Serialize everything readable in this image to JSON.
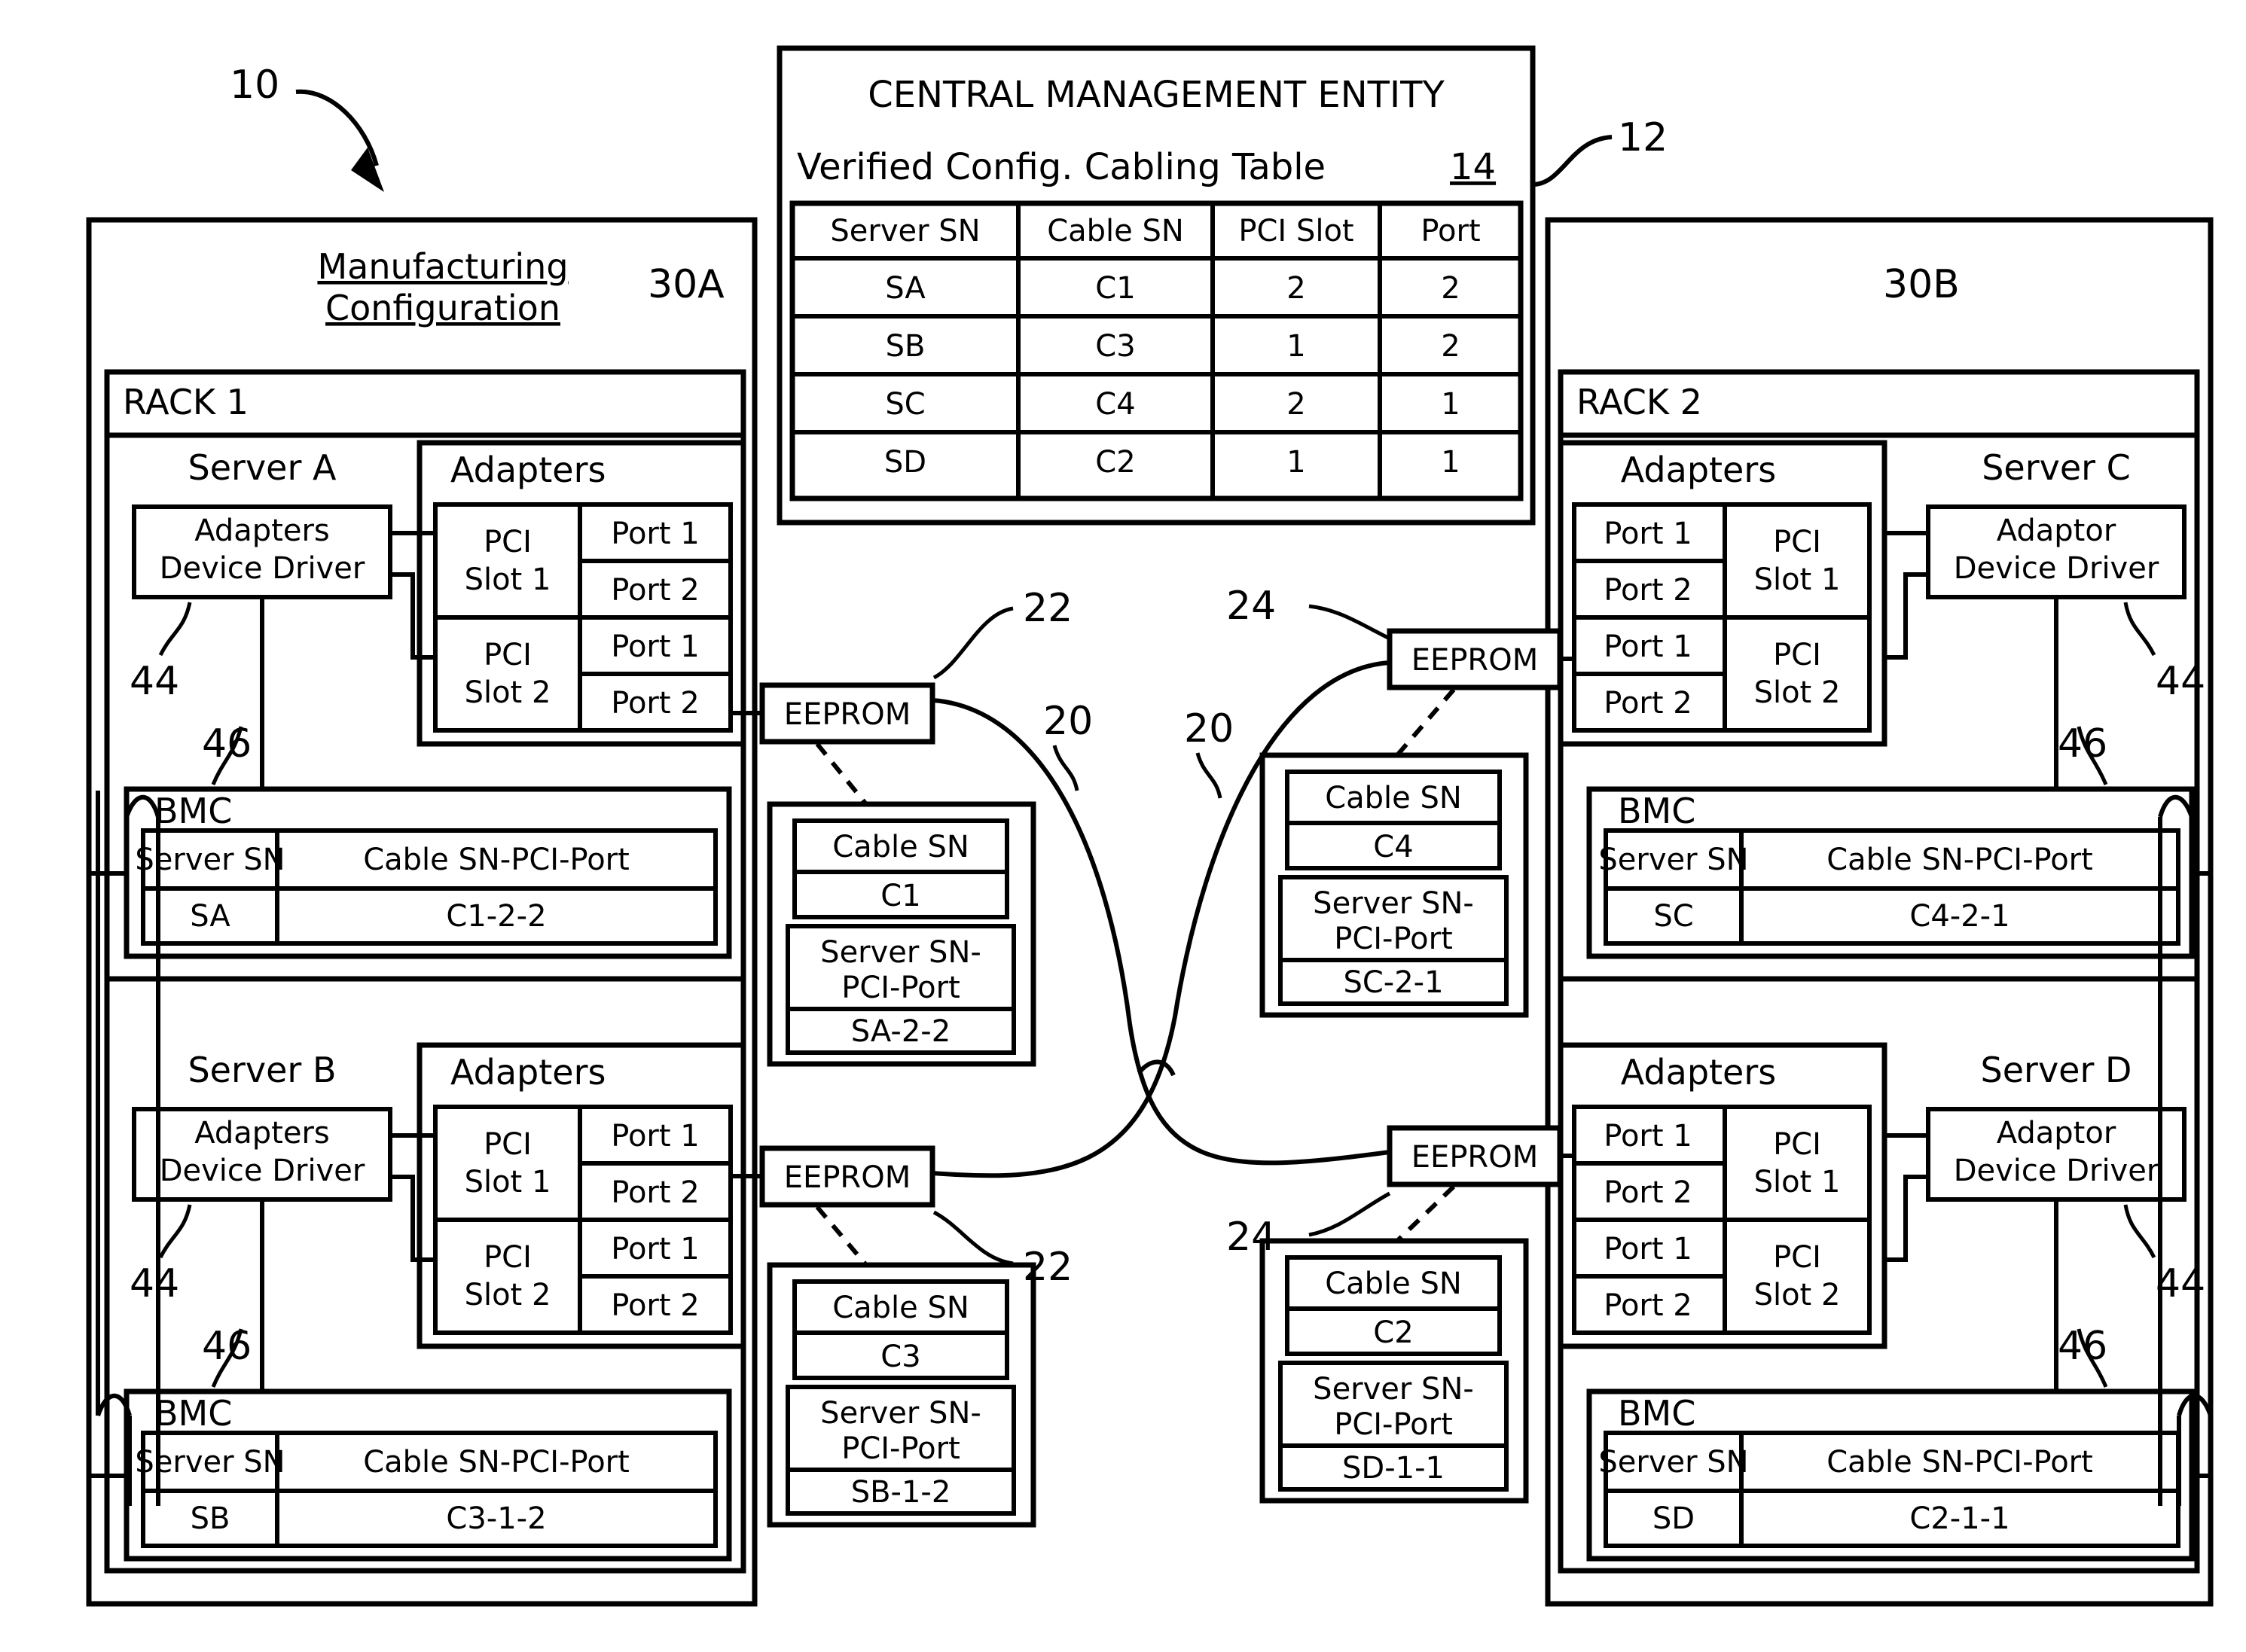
{
  "figure": {
    "ref_system": "10",
    "ref_cme": "12",
    "ref_table": "14",
    "ref_cable_20": "20",
    "ref_cable_22": "22",
    "ref_cable_24": "24",
    "ref_rack_a": "30A",
    "ref_rack_b": "30B",
    "ref_driver": "44",
    "ref_bmc": "46"
  },
  "central_management_entity": {
    "title": "CENTRAL MANAGEMENT ENTITY",
    "table_title": "Verified Config. Cabling Table",
    "table_ref": "14",
    "columns": [
      "Server SN",
      "Cable SN",
      "PCI Slot",
      "Port"
    ],
    "rows": [
      [
        "SA",
        "C1",
        "2",
        "2"
      ],
      [
        "SB",
        "C3",
        "1",
        "2"
      ],
      [
        "SC",
        "C4",
        "2",
        "1"
      ],
      [
        "SD",
        "C2",
        "1",
        "1"
      ]
    ]
  },
  "left_panel": {
    "heading_line1": "Manufacturing",
    "heading_line2": "Configuration",
    "rack_label": "RACK 1",
    "rack_ref": "30A",
    "servers": [
      {
        "name": "Server A",
        "driver_line1": "Adapters",
        "driver_line2": "Device Driver",
        "driver_ref": "44",
        "adapters_label": "Adapters",
        "slots": [
          {
            "slot": "PCI\nSlot 1",
            "slot_l1": "PCI",
            "slot_l2": "Slot 1",
            "ports": [
              "Port 1",
              "Port 2"
            ]
          },
          {
            "slot": "PCI\nSlot 2",
            "slot_l1": "PCI",
            "slot_l2": "Slot 2",
            "ports": [
              "Port 1",
              "Port 2"
            ]
          }
        ],
        "bmc_label": "BMC",
        "bmc_ref": "46",
        "bmc_columns": [
          "Server SN",
          "Cable SN-PCI-Port"
        ],
        "bmc_row": [
          "SA",
          "C1-2-2"
        ]
      },
      {
        "name": "Server B",
        "driver_line1": "Adapters",
        "driver_line2": "Device Driver",
        "driver_ref": "44",
        "adapters_label": "Adapters",
        "slots": [
          {
            "slot_l1": "PCI",
            "slot_l2": "Slot 1",
            "ports": [
              "Port 1",
              "Port 2"
            ]
          },
          {
            "slot_l1": "PCI",
            "slot_l2": "Slot 2",
            "ports": [
              "Port 1",
              "Port 2"
            ]
          }
        ],
        "bmc_label": "BMC",
        "bmc_ref": "46",
        "bmc_columns": [
          "Server SN",
          "Cable SN-PCI-Port"
        ],
        "bmc_row": [
          "SB",
          "C3-1-2"
        ]
      }
    ]
  },
  "right_panel": {
    "rack_label": "RACK 2",
    "rack_ref": "30B",
    "servers": [
      {
        "name": "Server C",
        "driver_line1": "Adaptor",
        "driver_line2": "Device Driver",
        "driver_ref": "44",
        "adapters_label": "Adapters",
        "slots": [
          {
            "slot_l1": "PCI",
            "slot_l2": "Slot 1",
            "ports": [
              "Port 1",
              "Port 2"
            ]
          },
          {
            "slot_l1": "PCI",
            "slot_l2": "Slot 2",
            "ports": [
              "Port 1",
              "Port 2"
            ]
          }
        ],
        "bmc_label": "BMC",
        "bmc_ref": "46",
        "bmc_columns": [
          "Server SN",
          "Cable SN-PCI-Port"
        ],
        "bmc_row": [
          "SC",
          "C4-2-1"
        ]
      },
      {
        "name": "Server D",
        "driver_line1": "Adaptor",
        "driver_line2": "Device Driver",
        "driver_ref": "44",
        "adapters_label": "Adapters",
        "slots": [
          {
            "slot_l1": "PCI",
            "slot_l2": "Slot 1",
            "ports": [
              "Port 1",
              "Port 2"
            ]
          },
          {
            "slot_l1": "PCI",
            "slot_l2": "Slot 2",
            "ports": [
              "Port 1",
              "Port 2"
            ]
          }
        ],
        "bmc_label": "BMC",
        "bmc_ref": "46",
        "bmc_columns": [
          "Server SN",
          "Cable SN-PCI-Port"
        ],
        "bmc_row": [
          "SD",
          "C2-1-1"
        ]
      }
    ]
  },
  "eeproms": [
    {
      "id": "eeprom-a",
      "label": "EEPROM",
      "ref": "22"
    },
    {
      "id": "eeprom-b",
      "label": "EEPROM",
      "ref": "22"
    },
    {
      "id": "eeprom-c",
      "label": "EEPROM",
      "ref": "24"
    },
    {
      "id": "eeprom-d",
      "label": "EEPROM",
      "ref": "24"
    }
  ],
  "cable_records": [
    {
      "id": "cable-c1",
      "cable_sn_header": "Cable SN",
      "cable_sn_value": "C1",
      "mapping_header_l1": "Server SN-",
      "mapping_header_l2": "PCI-Port",
      "mapping_value": "SA-2-2"
    },
    {
      "id": "cable-c3",
      "cable_sn_header": "Cable SN",
      "cable_sn_value": "C3",
      "mapping_header_l1": "Server SN-",
      "mapping_header_l2": "PCI-Port",
      "mapping_value": "SB-1-2"
    },
    {
      "id": "cable-c4",
      "cable_sn_header": "Cable SN",
      "cable_sn_value": "C4",
      "mapping_header_l1": "Server SN-",
      "mapping_header_l2": "PCI-Port",
      "mapping_value": "SC-2-1"
    },
    {
      "id": "cable-c2",
      "cable_sn_header": "Cable SN",
      "cable_sn_value": "C2",
      "mapping_header_l1": "Server SN-",
      "mapping_header_l2": "PCI-Port",
      "mapping_value": "SD-1-1"
    }
  ],
  "cable_refs": {
    "upper_left": "20",
    "upper_right": "20"
  }
}
